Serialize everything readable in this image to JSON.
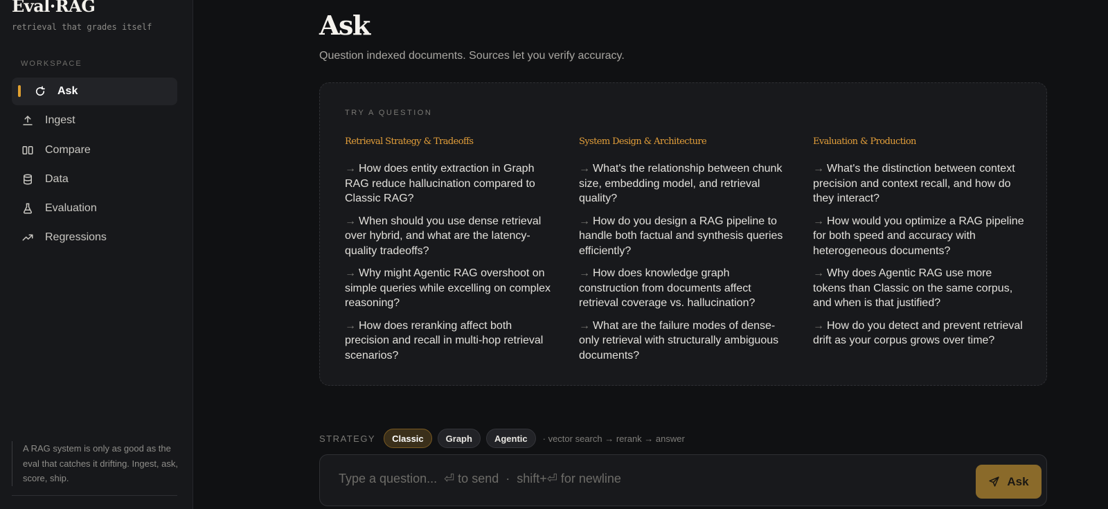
{
  "sidebar": {
    "brand": "Eval·RAG",
    "tagline": "retrieval that grades itself",
    "section_label": "WORKSPACE",
    "items": [
      {
        "label": "Ask",
        "icon": "refresh-icon",
        "active": true
      },
      {
        "label": "Ingest",
        "icon": "upload-icon"
      },
      {
        "label": "Compare",
        "icon": "columns-icon"
      },
      {
        "label": "Data",
        "icon": "database-icon"
      },
      {
        "label": "Evaluation",
        "icon": "flask-icon"
      },
      {
        "label": "Regressions",
        "icon": "trending-up-icon"
      }
    ],
    "quote": "A RAG system is only as good as the eval that catches it drifting. Ingest, ask, score, ship."
  },
  "main": {
    "title": "Ask",
    "subtitle": "Question indexed documents. Sources let you verify accuracy.",
    "card": {
      "label": "TRY A QUESTION",
      "columns": [
        {
          "heading": "Retrieval Strategy & Tradeoffs",
          "questions": [
            "How does entity extraction in Graph RAG reduce hallucination compared to Classic RAG?",
            "When should you use dense retrieval over hybrid, and what are the latency-quality tradeoffs?",
            "Why might Agentic RAG overshoot on simple queries while excelling on complex reasoning?",
            "How does reranking affect both precision and recall in multi-hop retrieval scenarios?"
          ]
        },
        {
          "heading": "System Design & Architecture",
          "questions": [
            "What's the relationship between chunk size, embedding model, and retrieval quality?",
            "How do you design a RAG pipeline to handle both factual and synthesis queries efficiently?",
            "How does knowledge graph construction from documents affect retrieval coverage vs. hallucination?",
            "What are the failure modes of dense-only retrieval with structurally ambiguous documents?"
          ]
        },
        {
          "heading": "Evaluation & Production",
          "questions": [
            "What's the distinction between context precision and context recall, and how do they interact?",
            "How would you optimize a RAG pipeline for both speed and accuracy with heterogeneous documents?",
            "Why does Agentic RAG use more tokens than Classic on the same corpus, and when is that justified?",
            "How do you detect and prevent retrieval drift as your corpus grows over time?"
          ]
        }
      ]
    },
    "strategy": {
      "label": "STRATEGY",
      "options": [
        "Classic",
        "Graph",
        "Agentic"
      ],
      "selected": "Classic",
      "hint": "· vector search → rerank → answer"
    },
    "input": {
      "placeholder": "Type a question...  ⏎ to send  ·  shift+⏎ for newline",
      "value": "",
      "button_label": "Ask"
    }
  },
  "colors": {
    "accent": "#e0a030",
    "background": "#101113",
    "sidebar": "#17181b"
  }
}
